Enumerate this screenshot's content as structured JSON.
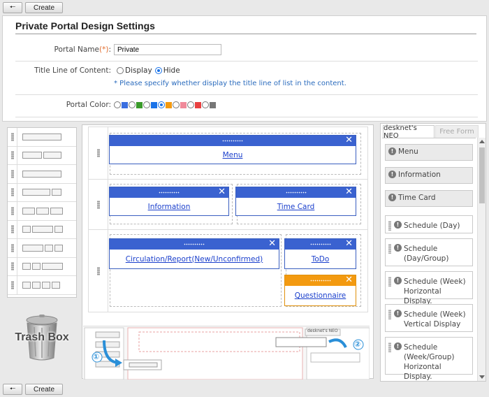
{
  "toolbar": {
    "back_icon": "back-arrow-icon",
    "create_label": "Create"
  },
  "page": {
    "title": "Private Portal Design Settings"
  },
  "form": {
    "portal_name": {
      "label": "Portal Name",
      "required_mark": "(*)",
      "colon": ":",
      "value": "Private"
    },
    "title_line": {
      "label": "Title Line of Content:",
      "options": [
        "Display",
        "Hide"
      ],
      "selected": "Hide",
      "note": "* Please specify whether display the title line of list in the content."
    },
    "portal_color": {
      "label": "Portal Color:",
      "colors": [
        "#3b6fe0",
        "#3a9a2a",
        "#1a73e8",
        "#f39a10",
        "#f08a9a",
        "#e84040",
        "#777777"
      ],
      "selected_index": 3
    }
  },
  "trash": {
    "label": "Trash Box"
  },
  "widgets": {
    "menu": "Menu",
    "information": "Information",
    "time_card": "Time Card",
    "circulation": "Circulation/Report(New/Unconfirmed)",
    "todo": "ToDo",
    "questionnaire": "Questionnaire"
  },
  "help": {
    "tab_label": "desknet's NEO",
    "step1": "①",
    "step2": "②"
  },
  "parts_panel": {
    "tabs": [
      "desknet's NEO",
      "Free Form"
    ],
    "fixed": [
      "Menu",
      "Information",
      "Time Card"
    ],
    "items": [
      "Schedule (Day)",
      "Schedule (Day/Group)",
      "Schedule (Week) Horizontal Display.",
      "Schedule (Week) Vertical Display",
      "Schedule (Week/Group) Horizontal Display."
    ]
  },
  "colors": {
    "header_blue": "#3a62d0",
    "header_orange": "#f39a10",
    "link": "#1a3fcc"
  }
}
